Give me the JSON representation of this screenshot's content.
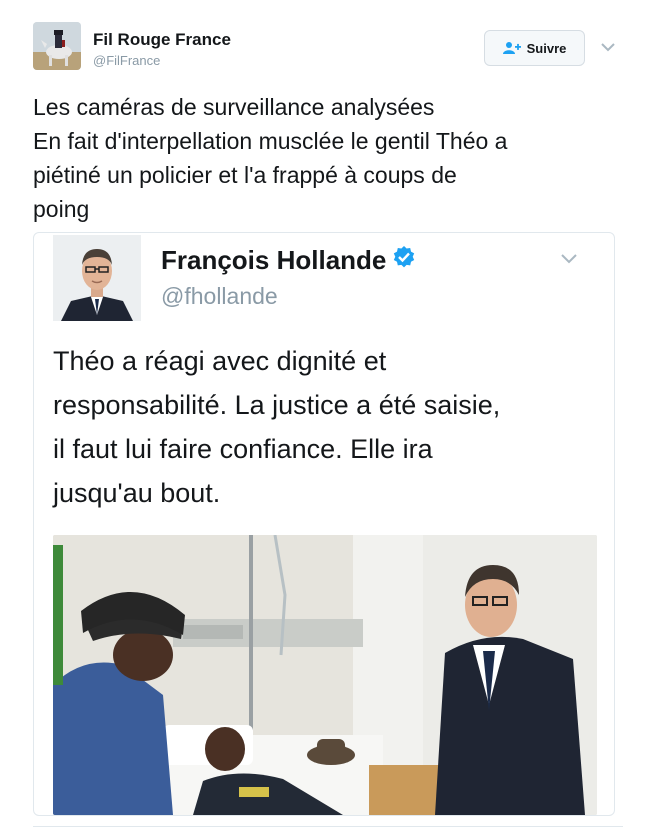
{
  "tweet": {
    "author_name": "Fil Rouge France",
    "author_handle": "@FilFrance",
    "follow_label": "Suivre",
    "text_lines": [
      "Les caméras de surveillance analysées",
      "En fait d'interpellation musclée le gentil Théo a",
      "piétiné un policier et l'a frappé à  coups de",
      "poing"
    ]
  },
  "quoted_tweet": {
    "author_name": "François Hollande",
    "author_handle": "@fhollande",
    "verified": true,
    "text_lines": [
      "Théo a réagi avec dignité et",
      "responsabilité. La justice a été saisie,",
      "il faut lui faire confiance. Elle ira",
      "jusqu'au bout."
    ]
  },
  "colors": {
    "verified_badge": "#1da1f2",
    "handle_text": "#8a9aa6",
    "border": "#e1e8ed"
  },
  "icons": {
    "follow": "add-user-icon",
    "menu": "chevron-down-icon",
    "verified": "verified-badge-icon"
  }
}
